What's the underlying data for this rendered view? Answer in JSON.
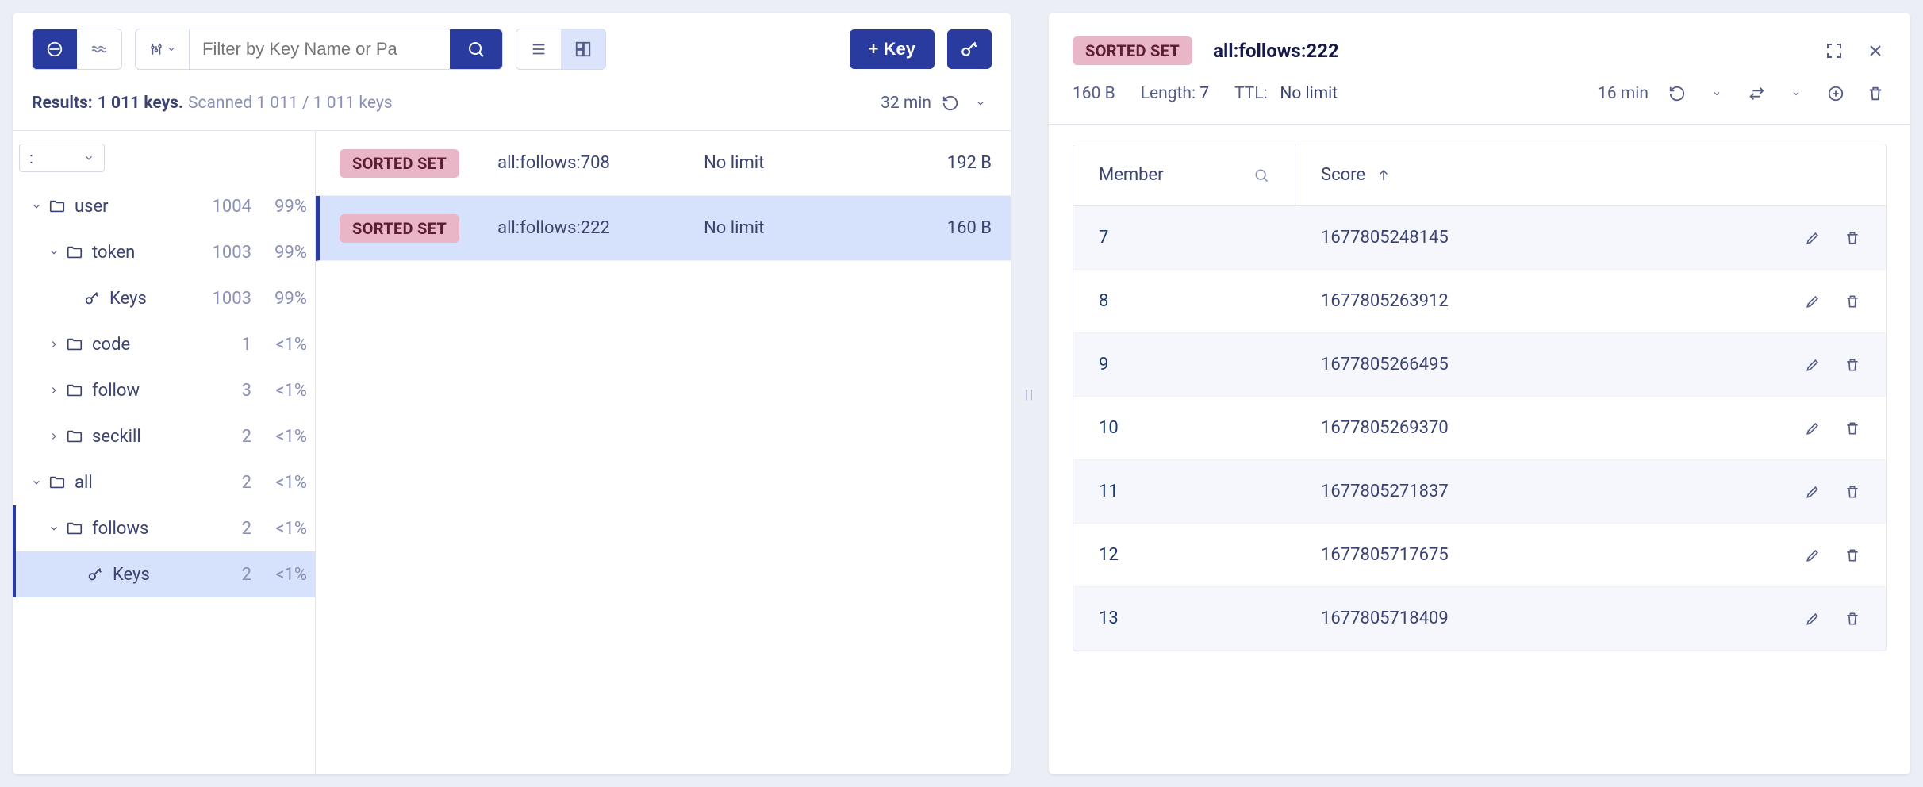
{
  "toolbar": {
    "filter_placeholder": "Filter by Key Name or Pa",
    "add_key_label": "+ Key"
  },
  "results": {
    "prefix": "Results:",
    "keys_count": "1 011 keys.",
    "scanned": "Scanned 1 011 / 1 011 keys",
    "time": "32 min"
  },
  "delim": {
    "value": ":"
  },
  "tree": [
    {
      "label": "user",
      "count": "1004",
      "pct": "99%",
      "open": true,
      "indent": 0,
      "type": "folder"
    },
    {
      "label": "token",
      "count": "1003",
      "pct": "99%",
      "open": true,
      "indent": 1,
      "type": "folder"
    },
    {
      "label": "Keys",
      "count": "1003",
      "pct": "99%",
      "open": false,
      "indent": 2,
      "type": "keys"
    },
    {
      "label": "code",
      "count": "1",
      "pct": "<1%",
      "open": false,
      "indent": 1,
      "type": "folder"
    },
    {
      "label": "follow",
      "count": "3",
      "pct": "<1%",
      "open": false,
      "indent": 1,
      "type": "folder"
    },
    {
      "label": "seckill",
      "count": "2",
      "pct": "<1%",
      "open": false,
      "indent": 1,
      "type": "folder"
    },
    {
      "label": "all",
      "count": "2",
      "pct": "<1%",
      "open": true,
      "indent": 0,
      "type": "folder"
    },
    {
      "label": "follows",
      "count": "2",
      "pct": "<1%",
      "open": true,
      "indent": 1,
      "type": "folder",
      "near_selected": true
    },
    {
      "label": "Keys",
      "count": "2",
      "pct": "<1%",
      "open": false,
      "indent": 2,
      "type": "keys",
      "selected": true
    }
  ],
  "keys_list": [
    {
      "badge": "SORTED SET",
      "name": "all:follows:708",
      "ttl": "No limit",
      "size": "192 B",
      "selected": false
    },
    {
      "badge": "SORTED SET",
      "name": "all:follows:222",
      "ttl": "No limit",
      "size": "160 B",
      "selected": true
    }
  ],
  "detail": {
    "badge": "SORTED SET",
    "title": "all:follows:222",
    "size": "160 B",
    "length_label": "Length:",
    "length_value": "7",
    "ttl_label": "TTL:",
    "ttl_value": "No limit",
    "time": "16 min",
    "headers": {
      "member": "Member",
      "score": "Score"
    },
    "rows": [
      {
        "member": "7",
        "score": "1677805248145"
      },
      {
        "member": "8",
        "score": "1677805263912"
      },
      {
        "member": "9",
        "score": "1677805266495"
      },
      {
        "member": "10",
        "score": "1677805269370"
      },
      {
        "member": "11",
        "score": "1677805271837"
      },
      {
        "member": "12",
        "score": "1677805717675"
      },
      {
        "member": "13",
        "score": "1677805718409"
      }
    ]
  }
}
